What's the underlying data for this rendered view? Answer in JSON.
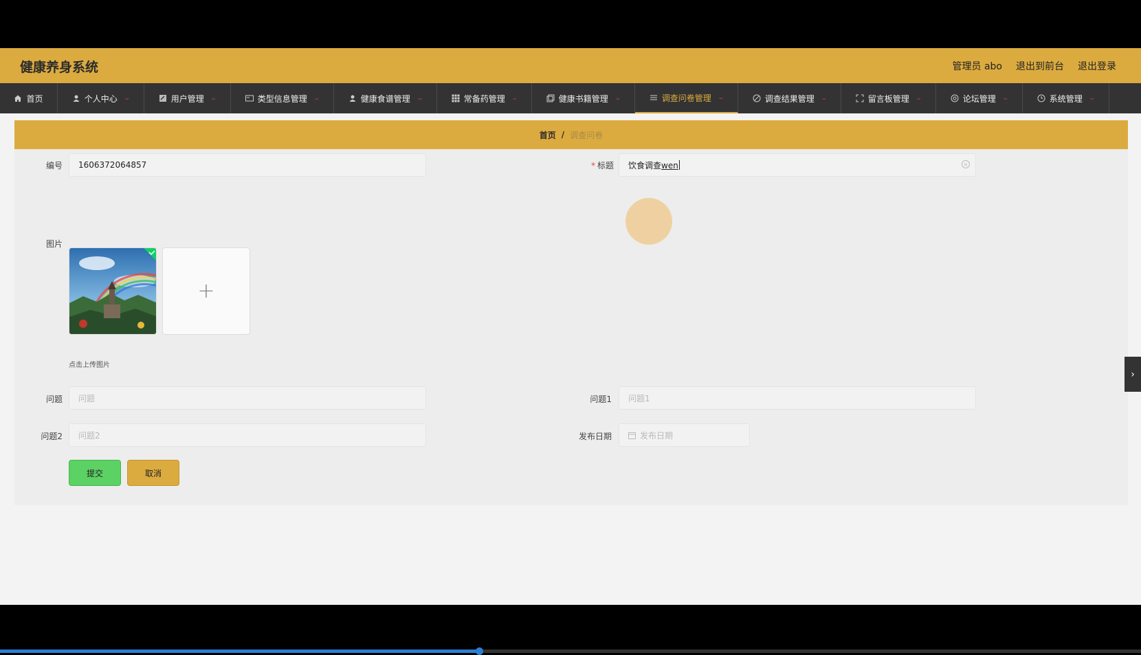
{
  "header": {
    "brand": "健康养身系统",
    "links": [
      "管理员 abo",
      "退出到前台",
      "退出登录"
    ]
  },
  "nav": {
    "items": [
      {
        "label": "首页",
        "icon": "home-icon",
        "caret": false
      },
      {
        "label": "个人中心",
        "icon": "user-icon",
        "caret": true
      },
      {
        "label": "用户管理",
        "icon": "edit-icon",
        "caret": true
      },
      {
        "label": "类型信息管理",
        "icon": "card-icon",
        "caret": true
      },
      {
        "label": "健康食谱管理",
        "icon": "user-icon",
        "caret": true
      },
      {
        "label": "常备药管理",
        "icon": "grid-icon",
        "caret": true
      },
      {
        "label": "健康书籍管理",
        "icon": "copy-icon",
        "caret": true
      },
      {
        "label": "调查问卷管理",
        "icon": "list-icon",
        "caret": true,
        "active": true
      },
      {
        "label": "调查结果管理",
        "icon": "pen-icon",
        "caret": true
      },
      {
        "label": "留言板管理",
        "icon": "fullscreen-icon",
        "caret": true
      },
      {
        "label": "论坛管理",
        "icon": "settings-icon",
        "caret": true
      },
      {
        "label": "系统管理",
        "icon": "clock-icon",
        "caret": true
      }
    ],
    "caret_icon": "chevron-down-icon"
  },
  "breadcrumb": {
    "home": "首页",
    "separator": "/",
    "current": "调查问卷"
  },
  "form": {
    "id_label": "编号",
    "id_value": "1606372064857",
    "title_label": "标题",
    "title_value_prefix": "饮食调查",
    "title_value_composing": "wen",
    "image_label": "图片",
    "upload_plus": "+",
    "upload_tip": "点击上传图片",
    "question_label": "问题",
    "question_placeholder": "问题",
    "question1_label": "问题1",
    "question1_placeholder": "问题1",
    "question2_label": "问题2",
    "question2_placeholder": "问题2",
    "date_label": "发布日期",
    "date_placeholder": "发布日期",
    "submit_label": "提交",
    "cancel_label": "取消"
  },
  "side_tab": {
    "icon": "chevron-right-icon",
    "glyph": "›"
  },
  "video_progress": 0.42,
  "colors": {
    "accent": "#dcab3f",
    "nav_bg": "#333333",
    "submit": "#5cd164",
    "required": "#ee4444"
  }
}
